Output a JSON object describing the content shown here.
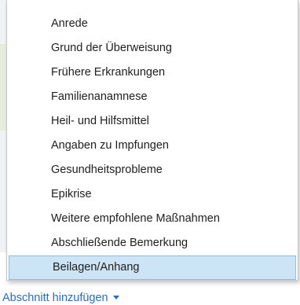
{
  "menu": {
    "items": [
      {
        "label": "Anrede"
      },
      {
        "label": "Grund der Überweisung"
      },
      {
        "label": "Frühere Erkrankungen"
      },
      {
        "label": "Familienanamnese"
      },
      {
        "label": "Heil- und Hilfsmittel"
      },
      {
        "label": "Angaben zu Impfungen"
      },
      {
        "label": "Gesundheitsprobleme"
      },
      {
        "label": "Epikrise"
      },
      {
        "label": "Weitere empfohlene Maßnahmen"
      },
      {
        "label": "Abschließende Bemerkung"
      },
      {
        "label": "Beilagen/Anhang"
      }
    ],
    "selected": "Beilagen/Anhang"
  },
  "footer": {
    "add_section_label": "Abschnitt hinzufügen"
  },
  "colors": {
    "selected_bg": "#cde4f7",
    "selected_border": "#8fbde6",
    "link": "#2b6cb7"
  }
}
